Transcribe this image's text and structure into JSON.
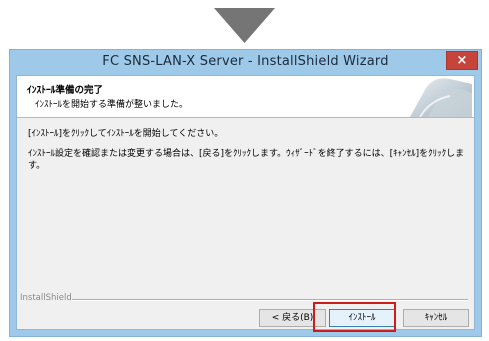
{
  "window": {
    "title": "FC SNS-LAN-X Server - InstallShield Wizard",
    "close_glyph": "×"
  },
  "header": {
    "title": "ｲﾝｽﾄｰﾙ準備の完了",
    "subtitle": "ｲﾝｽﾄｰﾙを開始する準備が整いました。"
  },
  "body": {
    "line1": "[ｲﾝｽﾄｰﾙ]をｸﾘｯｸしてｲﾝｽﾄｰﾙを開始してください。",
    "line2": "ｲﾝｽﾄｰﾙ設定を確認または変更する場合は、[戻る]をｸﾘｯｸします。ｳｨｻﾞｰﾄﾞを終了するには、[ｷｬﾝｾﾙ]をｸﾘｯｸします。"
  },
  "footer": {
    "brand": "InstallShield",
    "back_label": "< 戻る(B)",
    "install_label": "ｲﾝｽﾄｰﾙ",
    "cancel_label": "ｷｬﾝｾﾙ"
  },
  "colors": {
    "highlight": "#cc1d1d",
    "title_bar": "#9fc9e8",
    "close": "#c7443a"
  }
}
